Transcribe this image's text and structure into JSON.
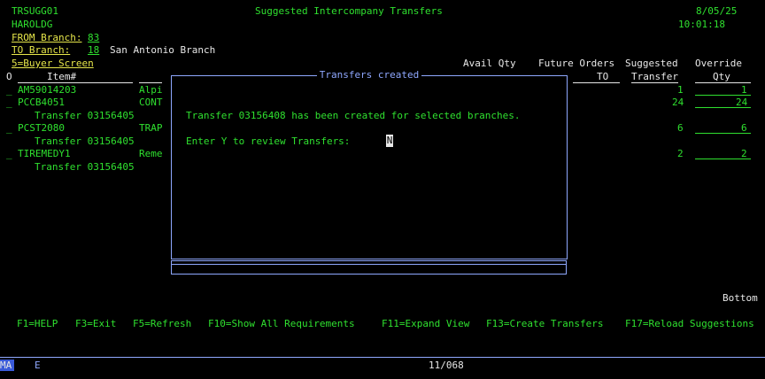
{
  "header": {
    "program": "TRSUGG01",
    "user": "HAROLDG",
    "title": "Suggested Intercompany Transfers",
    "date": "8/05/25",
    "time": "10:01:18"
  },
  "fields": {
    "from_label": "FROM Branch:",
    "from_value": "83",
    "to_label": "TO Branch:",
    "to_value": "18",
    "to_name": "San Antonio Branch",
    "buyer_screen": "5=Buyer Screen"
  },
  "columns": {
    "o": "O",
    "item": "Item#",
    "avail_qty": "Avail Qty",
    "future_orders": "Future Orders",
    "future_to": "TO",
    "suggested": "Suggested",
    "suggested_sub": "Transfer",
    "override": "Override",
    "override_sub": "Qty"
  },
  "rows": [
    {
      "opt": "_",
      "item": "AM59014203",
      "desc": "Alpi",
      "suggested": "1",
      "override": "1",
      "transfer": ""
    },
    {
      "opt": "_",
      "item": "PCCB4051",
      "desc": "CONT",
      "suggested": "24",
      "override": "24",
      "transfer": "Transfer 03156405"
    },
    {
      "opt": "_",
      "item": "PCST2080",
      "desc": "TRAP",
      "suggested": "6",
      "override": "6",
      "transfer": "Transfer 03156405"
    },
    {
      "opt": "_",
      "item": "TIREMEDY1",
      "desc": "Reme",
      "suggested": "2",
      "override": "2",
      "transfer": "Transfer 03156405"
    }
  ],
  "dialog": {
    "title": "Transfers created",
    "message": "Transfer 03156408 has been created for selected branches.",
    "prompt": "Enter Y to review Transfers:",
    "input_value": "N"
  },
  "bottom_label": "Bottom",
  "fkeys": [
    "F1=HELP",
    "F3=Exit",
    "F5=Refresh",
    "F10=Show All Requirements",
    "F11=Expand View",
    "F13=Create Transfers",
    "F17=Reload Suggestions"
  ],
  "status": {
    "indicator": "MA",
    "mode": "E",
    "cursor_pos": "11/068"
  }
}
